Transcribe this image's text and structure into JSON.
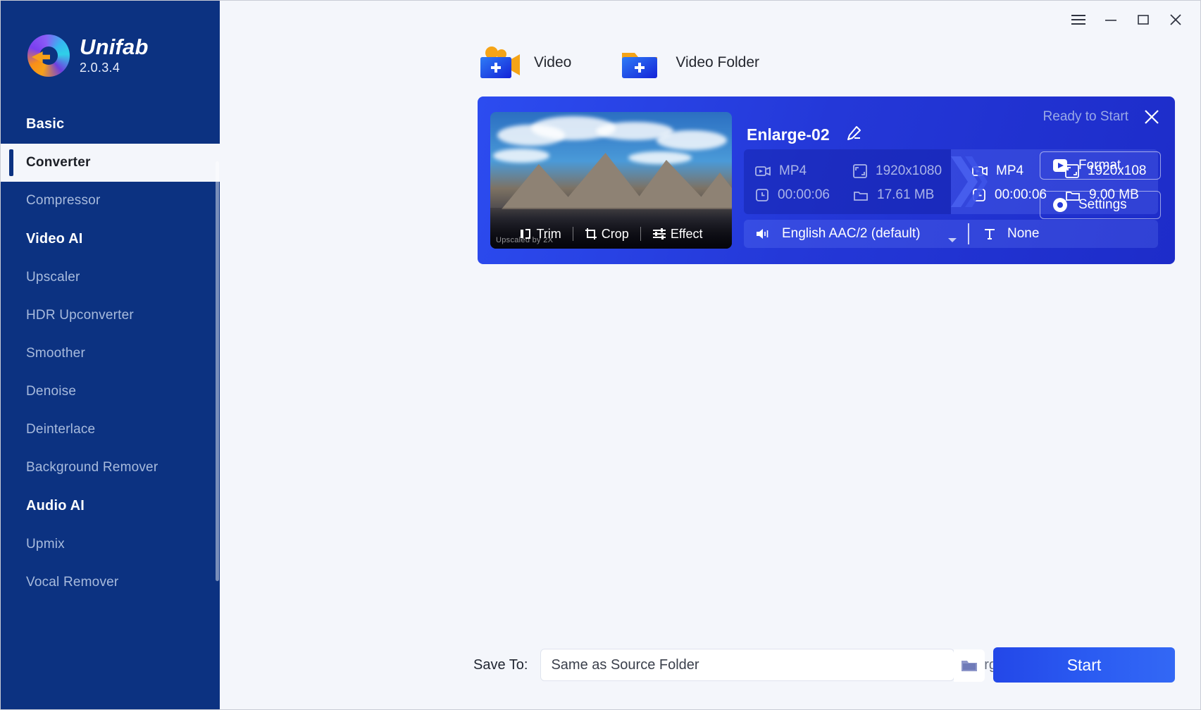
{
  "app": {
    "brand_name": "Unifab",
    "version": "2.0.3.4"
  },
  "titlebar": {
    "menu": "menu-icon",
    "minimize": "minimize-icon",
    "maximize": "maximize-icon",
    "close": "close-icon"
  },
  "sidebar": {
    "groups": [
      {
        "label": "Basic",
        "items": [
          {
            "label": "Converter",
            "active": true
          },
          {
            "label": "Compressor",
            "active": false
          }
        ]
      },
      {
        "label": "Video AI",
        "items": [
          {
            "label": "Upscaler",
            "active": false
          },
          {
            "label": "HDR Upconverter",
            "active": false
          },
          {
            "label": "Smoother",
            "active": false
          },
          {
            "label": "Denoise",
            "active": false
          },
          {
            "label": "Deinterlace",
            "active": false
          },
          {
            "label": "Background Remover",
            "active": false
          }
        ]
      },
      {
        "label": "Audio AI",
        "items": [
          {
            "label": "Upmix",
            "active": false
          },
          {
            "label": "Vocal Remover",
            "active": false
          }
        ]
      }
    ]
  },
  "toolbar": {
    "add_video_label": "Video",
    "add_folder_label": "Video Folder"
  },
  "file_card": {
    "status": "Ready to Start",
    "title": "Enlarge-02",
    "thumbnail_watermark": "Upscaled by 2X",
    "thumb_tools": [
      {
        "label": "Trim",
        "icon": "trim-icon"
      },
      {
        "label": "Crop",
        "icon": "crop-icon"
      },
      {
        "label": "Effect",
        "icon": "effect-icon"
      }
    ],
    "source": {
      "format": "MP4",
      "resolution": "1920x1080",
      "duration": "00:00:06",
      "size": "17.61 MB"
    },
    "target": {
      "format": "MP4",
      "resolution": "1920x108",
      "duration": "00:00:06",
      "size": "9.00 MB"
    },
    "audio_track": "English AAC/2 (default)",
    "subtitle_track": "None",
    "format_button": "Format",
    "settings_button": "Settings"
  },
  "bottom": {
    "save_to_label": "Save To:",
    "save_to_value": "Same as Source Folder",
    "merge_label": "Merge all files",
    "merge_enabled": false,
    "start_label": "Start"
  },
  "colors": {
    "sidebar_bg": "#0c3281",
    "card_blue": "#2438d8",
    "accent": "#2b5cf2",
    "page_bg": "#f4f6fb"
  }
}
